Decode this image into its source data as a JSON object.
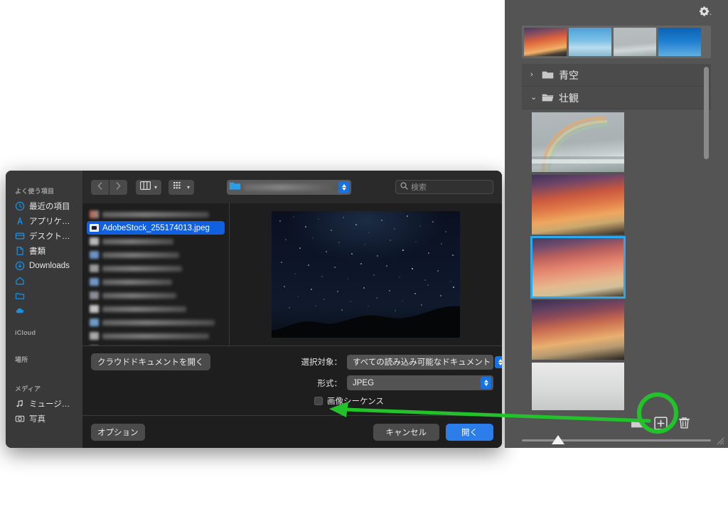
{
  "dialog": {
    "sidebar": {
      "sections": [
        {
          "header": "よく使う項目",
          "items": [
            {
              "label": "最近の項目",
              "icon": "clock-icon"
            },
            {
              "label": "アプリケ…",
              "icon": "applications-icon"
            },
            {
              "label": "デスクト…",
              "icon": "desktop-icon"
            },
            {
              "label": "書類",
              "icon": "documents-icon"
            },
            {
              "label": "Downloads",
              "icon": "downloads-icon"
            },
            {
              "label": "",
              "icon": "home-icon"
            },
            {
              "label": "",
              "icon": "folder-icon"
            },
            {
              "label": "",
              "icon": "cloud-icon"
            }
          ]
        },
        {
          "header": "iCloud",
          "items": []
        },
        {
          "header": "場所",
          "items": []
        },
        {
          "header": "メディア",
          "items": [
            {
              "label": "ミュージ…",
              "icon": "music-icon"
            },
            {
              "label": "写真",
              "icon": "photos-icon"
            }
          ]
        }
      ]
    },
    "toolbar": {
      "back_icon": "chevron-left-icon",
      "forward_icon": "chevron-right-icon",
      "view_column_icon": "column-view-icon",
      "view_icon_icon": "icon-view-icon",
      "path_popup_icon": "blue-folder-icon",
      "search_placeholder": "検索",
      "search_icon": "search-icon"
    },
    "file_list": {
      "selected_filename": "AdobeStock_255174013.jpeg",
      "blurred_row_count": 11
    },
    "preview": {
      "alt": "starry-night-sky-photo"
    },
    "options": {
      "cloud_documents_label": "クラウドドキュメントを開く",
      "enable_label": "選択対象：",
      "enable_value": "すべての読み込み可能なドキュメント",
      "format_label": "形式：",
      "format_value": "JPEG",
      "image_sequence_label": "画像シーケンス",
      "image_sequence_checked": false
    },
    "footer": {
      "options_label": "オプション",
      "cancel_label": "キャンセル",
      "open_label": "開く"
    }
  },
  "photo_panel": {
    "gear_icon": "gear-icon",
    "strip_thumbs": [
      {
        "name": "sunset-clouds-thumb"
      },
      {
        "name": "blue-sky-clouds-thumb"
      },
      {
        "name": "rainbow-ocean-thumb"
      },
      {
        "name": "blue-gradient-sky-thumb"
      }
    ],
    "folders": [
      {
        "label": "青空",
        "expanded": false
      },
      {
        "label": "壮観",
        "expanded": true
      }
    ],
    "thumbnails": [
      {
        "name": "rainbow-ocean-item",
        "selected": false
      },
      {
        "name": "sunset-orange-item",
        "selected": false
      },
      {
        "name": "sunset-pink-item",
        "selected": true
      },
      {
        "name": "sunset-deep-item",
        "selected": false
      },
      {
        "name": "cloudy-white-item",
        "selected": false
      }
    ],
    "bottom_icons": [
      {
        "name": "new-folder-icon"
      },
      {
        "name": "add-item-icon"
      },
      {
        "name": "delete-icon"
      }
    ],
    "zoom_slider_value": 15
  },
  "annotation": {
    "highlight_color": "#22c32a",
    "target_icon": "add-item-icon"
  }
}
